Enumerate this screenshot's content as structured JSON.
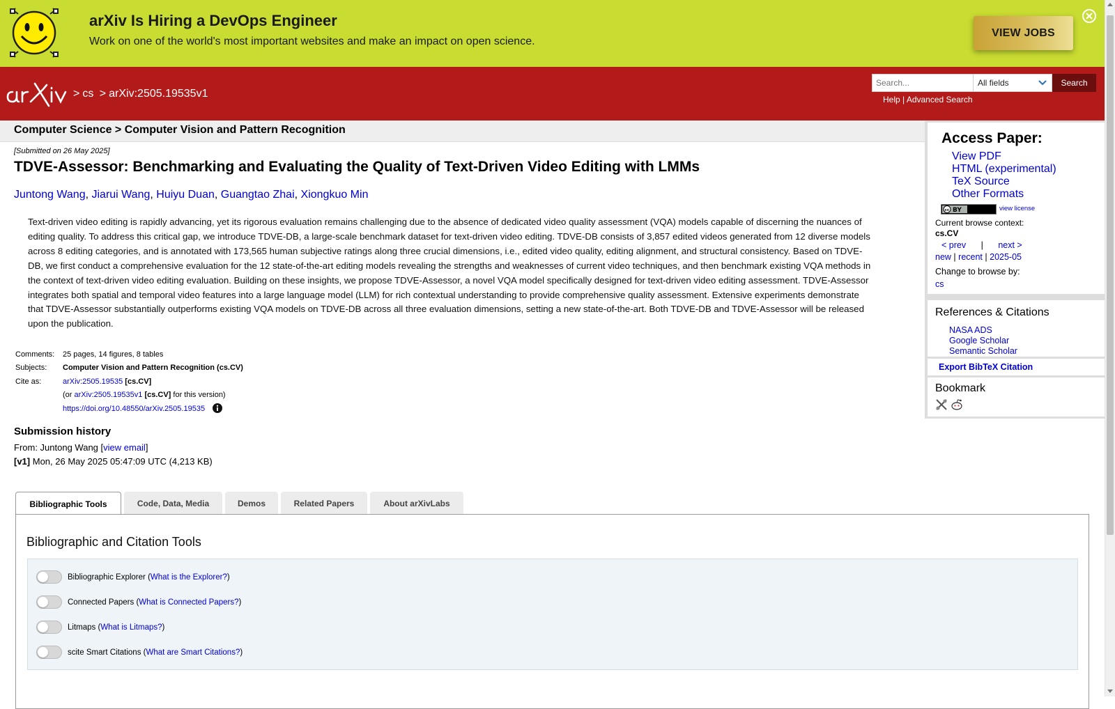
{
  "banner": {
    "title": "arXiv Is Hiring a DevOps Engineer",
    "text": "Work on one of the world's most important websites and make an impact on open science.",
    "button": "VIEW JOBS"
  },
  "header": {
    "crumb_cs": "cs",
    "crumb_id": "arXiv:2505.19535v1",
    "search_placeholder": "Search...",
    "field_value": "All fields",
    "search_button": "Search",
    "help": "Help",
    "advanced": "Advanced Search"
  },
  "main": {
    "subheader": "Computer Science > Computer Vision and Pattern Recognition",
    "submitted": "[Submitted on 26 May 2025]",
    "title": "TDVE-Assessor: Benchmarking and Evaluating the Quality of Text-Driven Video Editing with LMMs",
    "authors": [
      "Juntong Wang",
      "Jiarui Wang",
      "Huiyu Duan",
      "Guangtao Zhai",
      "Xiongkuo Min"
    ],
    "abstract_lines": [
      "Text-driven video editing is rapidly advancing, yet its rigorous evaluation remains challenging due to the absence of dedicated video quality assessment (VQA) models capable of discerning the nuances of",
      "editing quality. To address this critical gap, we introduce TDVE-DB, a large-scale benchmark dataset for text-driven video editing. TDVE-DB consists of 3,857 edited videos generated from 12 diverse models",
      "across 8 editing categories, and is annotated with 173,565 human subjective ratings along three crucial dimensions, i.e., edited video quality, editing alignment, and structural consistency. Based on TDVE-",
      "DB, we first conduct a comprehensive evaluation for the 12 state-of-the-art editing models revealing the strengths and weaknesses of current video techniques, and then benchmark existing VQA methods in",
      "the context of text-driven video editing evaluation. Building on these insights, we propose TDVE-Assessor, a novel VQA model specifically designed for text-driven video editing assessment. TDVE-Assessor",
      "integrates both spatial and temporal video features into a large language model (LLM) for rich contextual understanding to provide comprehensive quality assessment. Extensive experiments demonstrate",
      "that TDVE-Assessor substantially outperforms existing VQA models on TDVE-DB across all three evaluation dimensions, setting a new state-of-the-art. Both TDVE-DB and TDVE-Assessor will be released",
      "upon the publication."
    ],
    "comments_label": "Comments:",
    "comments": "25 pages, 14 figures, 8 tables",
    "subjects_label": "Subjects:",
    "subjects": "Computer Vision and Pattern Recognition (cs.CV)",
    "cite_label": "Cite as:",
    "cite_id": "arXiv:2505.19535",
    "cite_cat": "[cs.CV]",
    "cite_or": "(or",
    "cite_version": "arXiv:2505.19535v1",
    "cite_version_cat": "[cs.CV]",
    "cite_version_tail": "for this version)",
    "doi": "https://doi.org/10.48550/arXiv.2505.19535",
    "history_title": "Submission history",
    "history_from": "From: Juntong Wang [",
    "view_email": "view email",
    "history_from_end": "]",
    "v1_tag": "[v1]",
    "v1_text": "Mon, 26 May 2025 05:47:09 UTC (4,213 KB)"
  },
  "tabs": [
    {
      "label": "Bibliographic Tools",
      "active": true
    },
    {
      "label": "Code, Data, Media",
      "active": false
    },
    {
      "label": "Demos",
      "active": false
    },
    {
      "label": "Related Papers",
      "active": false
    },
    {
      "label": "About arXivLabs",
      "active": false
    }
  ],
  "panel": {
    "title": "Bibliographic and Citation Tools",
    "toggles": [
      {
        "label": "Bibliographic Explorer",
        "link": "What is the Explorer?"
      },
      {
        "label": "Connected Papers",
        "link": "What is Connected Papers?"
      },
      {
        "label": "Litmaps",
        "link": "What is Litmaps?"
      },
      {
        "label": "scite Smart Citations",
        "link": "What are Smart Citations?"
      }
    ]
  },
  "sidebar": {
    "access_title": "Access Paper:",
    "access_links": [
      "View PDF",
      "HTML (experimental)",
      "TeX Source",
      "Other Formats"
    ],
    "view_license": "view license",
    "context_label": "Current browse context:",
    "context_value": "cs.CV",
    "prev": "< prev",
    "sep": "|",
    "next": "next >",
    "new": "new",
    "recent": "recent",
    "month": "2025-05",
    "change_label": "Change to browse by:",
    "change_cs": "cs",
    "refs_title": "References & Citations",
    "refs_links": [
      "NASA ADS",
      "Google Scholar",
      "Semantic Scholar"
    ],
    "bibtex": "Export BibTeX Citation",
    "bookmark_title": "Bookmark"
  }
}
